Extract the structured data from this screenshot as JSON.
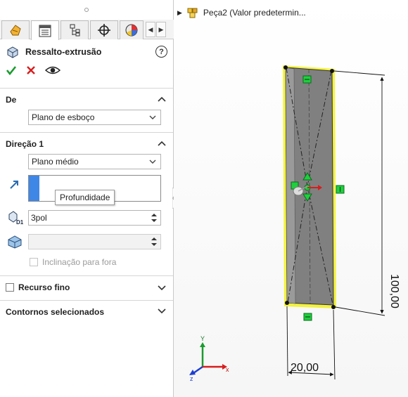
{
  "property_manager": {
    "title": "Ressalto-extrusão",
    "tabs": [
      "feature-manager",
      "property-manager",
      "configuration-manager",
      "dim-xpert-manager",
      "display-manager"
    ],
    "sections": {
      "from": {
        "label": "De",
        "value": "Plano de esboço"
      },
      "direction1": {
        "label": "Direção 1",
        "end_condition": "Plano médio",
        "tooltip": "Profundidade",
        "depth_value": "3pol",
        "depth_symbol": "D1",
        "draft_checkbox": "Inclinação para fora"
      },
      "thin_feature": {
        "label": "Recurso fino"
      },
      "selected_contours": {
        "label": "Contornos selecionados"
      }
    }
  },
  "viewport": {
    "tree_item": "Peça2 (Valor predetermin...",
    "dimensions": {
      "height": "100,00",
      "width": "20,00"
    },
    "axes": {
      "x": "x",
      "y": "Y",
      "z": "z"
    }
  },
  "colors": {
    "accent": "#3f87e6",
    "ok": "#1a9b2e",
    "cancel": "#d71e1e",
    "highlight": "#f2f000"
  }
}
